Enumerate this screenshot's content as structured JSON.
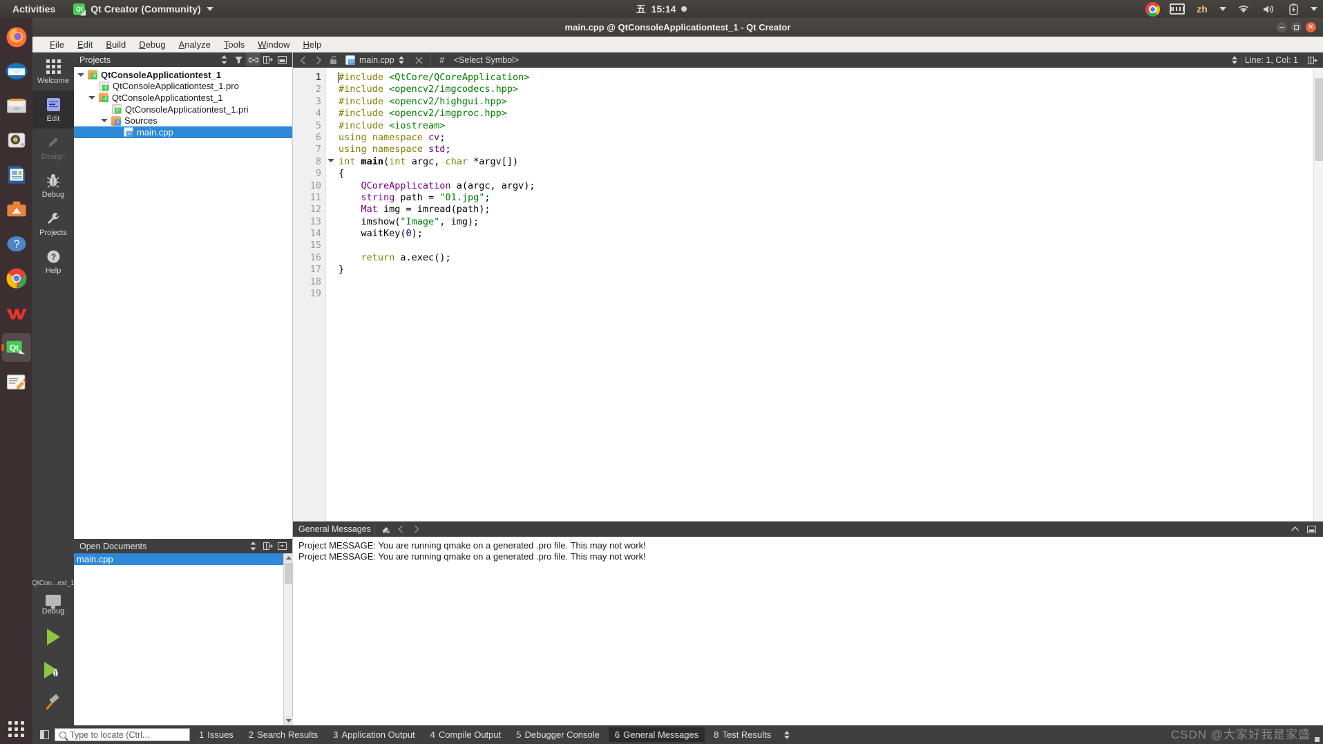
{
  "gnome": {
    "activities": "Activities",
    "app_name": "Qt Creator (Community)",
    "app_icon": "qt-icon",
    "clock_day": "五",
    "clock_time": "15:14",
    "keyboard_layout": "zh",
    "tray_icons": [
      "chrome-icon",
      "keyboard-icon",
      "language-indicator",
      "wifi-icon",
      "volume-icon",
      "battery-icon",
      "system-menu-chevron"
    ]
  },
  "dock": {
    "items": [
      {
        "name": "firefox",
        "label": "Firefox"
      },
      {
        "name": "thunderbird",
        "label": "Thunderbird"
      },
      {
        "name": "files",
        "label": "Files"
      },
      {
        "name": "rhythmbox",
        "label": "Rhythmbox"
      },
      {
        "name": "libreoffice",
        "label": "LibreOffice Writer"
      },
      {
        "name": "ubuntu-software",
        "label": "Ubuntu Software"
      },
      {
        "name": "help",
        "label": "Help"
      },
      {
        "name": "chrome",
        "label": "Google Chrome"
      },
      {
        "name": "wps",
        "label": "WPS Office"
      },
      {
        "name": "qtcreator",
        "label": "Qt Creator",
        "active": true
      },
      {
        "name": "text-editor",
        "label": "Text Editor"
      }
    ],
    "show_apps": "Show Applications"
  },
  "window": {
    "title": "main.cpp @ QtConsoleApplicationtest_1 - Qt Creator",
    "controls": {
      "minimize": "Minimize",
      "maximize": "Maximize",
      "close": "Close"
    }
  },
  "menubar": {
    "items": [
      {
        "label": "File",
        "mnemonic": "F"
      },
      {
        "label": "Edit",
        "mnemonic": "E"
      },
      {
        "label": "Build",
        "mnemonic": "B"
      },
      {
        "label": "Debug",
        "mnemonic": "D"
      },
      {
        "label": "Analyze",
        "mnemonic": "A"
      },
      {
        "label": "Tools",
        "mnemonic": "T"
      },
      {
        "label": "Window",
        "mnemonic": "W"
      },
      {
        "label": "Help",
        "mnemonic": "H"
      }
    ]
  },
  "modes": [
    {
      "label": "Welcome",
      "icon": "grid-icon",
      "state": "normal"
    },
    {
      "label": "Edit",
      "icon": "document-lines-icon",
      "state": "selected"
    },
    {
      "label": "Design",
      "icon": "pencil-icon",
      "state": "disabled"
    },
    {
      "label": "Debug",
      "icon": "bug-icon",
      "state": "normal"
    },
    {
      "label": "Projects",
      "icon": "wrench-icon",
      "state": "normal"
    },
    {
      "label": "Help",
      "icon": "question-circle-icon",
      "state": "normal"
    }
  ],
  "kit_selector": {
    "project": "QtCon...est_1",
    "build_config": "Debug",
    "target_icon": "desktop-icon",
    "run_button": "run-icon",
    "debug_button": "run-debug-icon",
    "build_button": "hammer-icon"
  },
  "projects_panel": {
    "title": "Projects",
    "toolbar": [
      "sync-chevrons-icon",
      "filter-icon",
      "link-icon",
      "split-icon",
      "close-panel-icon"
    ],
    "tree": [
      {
        "label": "QtConsoleApplicationtest_1",
        "depth": 0,
        "icon": "qt-project-folder-icon",
        "expander": "expanded",
        "bold": true,
        "selected": false
      },
      {
        "label": "QtConsoleApplicationtest_1.pro",
        "depth": 1,
        "icon": "qt-file-icon",
        "expander": "none",
        "bold": false,
        "selected": false
      },
      {
        "label": "QtConsoleApplicationtest_1",
        "depth": 1,
        "icon": "qt-project-folder-icon",
        "expander": "expanded",
        "bold": false,
        "selected": false
      },
      {
        "label": "QtConsoleApplicationtest_1.pri",
        "depth": 2,
        "icon": "qt-file-icon",
        "expander": "none",
        "bold": false,
        "selected": false
      },
      {
        "label": "Sources",
        "depth": 2,
        "icon": "cpp-folder-icon",
        "expander": "expanded",
        "bold": false,
        "selected": false
      },
      {
        "label": "main.cpp",
        "depth": 3,
        "icon": "cpp-file-icon",
        "expander": "none",
        "bold": false,
        "selected": true
      }
    ]
  },
  "open_documents": {
    "title": "Open Documents",
    "toolbar": [
      "sync-chevrons-icon",
      "split-icon",
      "close-panel-icon"
    ],
    "items": [
      {
        "label": "main.cpp",
        "selected": true
      }
    ]
  },
  "editor_toolbar": {
    "back": "back-arrow-icon",
    "forward": "forward-arrow-icon",
    "lock": "unlocked-icon",
    "file_icon": "cpp-file-icon",
    "file_name": "main.cpp",
    "close_file": "close-icon",
    "symbol_hash": "#",
    "symbol_selector": "<Select Symbol>",
    "cursor_position": "Line: 1, Col: 1",
    "split_editor": "split-icon"
  },
  "code": {
    "lines": [
      {
        "n": 1,
        "fold": false,
        "tokens": [
          {
            "t": "#include ",
            "c": "pre"
          },
          {
            "t": "<QtCore/QCoreApplication>",
            "c": "str"
          }
        ]
      },
      {
        "n": 2,
        "fold": false,
        "tokens": [
          {
            "t": "#include ",
            "c": "pre"
          },
          {
            "t": "<opencv2/imgcodecs.hpp>",
            "c": "str"
          }
        ]
      },
      {
        "n": 3,
        "fold": false,
        "tokens": [
          {
            "t": "#include ",
            "c": "pre"
          },
          {
            "t": "<opencv2/highgui.hpp>",
            "c": "str"
          }
        ]
      },
      {
        "n": 4,
        "fold": false,
        "tokens": [
          {
            "t": "#include ",
            "c": "pre"
          },
          {
            "t": "<opencv2/imgproc.hpp>",
            "c": "str"
          }
        ]
      },
      {
        "n": 5,
        "fold": false,
        "tokens": [
          {
            "t": "#include ",
            "c": "pre"
          },
          {
            "t": "<iostream>",
            "c": "str"
          }
        ]
      },
      {
        "n": 6,
        "fold": false,
        "tokens": [
          {
            "t": "using namespace ",
            "c": "kw"
          },
          {
            "t": "cv",
            "c": "type"
          },
          {
            "t": ";",
            "c": "plain"
          }
        ]
      },
      {
        "n": 7,
        "fold": false,
        "tokens": [
          {
            "t": "using namespace ",
            "c": "kw"
          },
          {
            "t": "std",
            "c": "type"
          },
          {
            "t": ";",
            "c": "plain"
          }
        ]
      },
      {
        "n": 8,
        "fold": true,
        "tokens": [
          {
            "t": "int ",
            "c": "kw"
          },
          {
            "t": "main",
            "c": "bold"
          },
          {
            "t": "(",
            "c": "plain"
          },
          {
            "t": "int ",
            "c": "kw"
          },
          {
            "t": "argc, ",
            "c": "plain"
          },
          {
            "t": "char ",
            "c": "kw"
          },
          {
            "t": "*argv[])",
            "c": "plain"
          }
        ]
      },
      {
        "n": 9,
        "fold": false,
        "tokens": [
          {
            "t": "{",
            "c": "plain"
          }
        ]
      },
      {
        "n": 10,
        "fold": false,
        "tokens": [
          {
            "t": "    ",
            "c": "plain"
          },
          {
            "t": "QCoreApplication",
            "c": "type"
          },
          {
            "t": " a(argc, argv);",
            "c": "plain"
          }
        ]
      },
      {
        "n": 11,
        "fold": false,
        "tokens": [
          {
            "t": "    ",
            "c": "plain"
          },
          {
            "t": "string",
            "c": "type"
          },
          {
            "t": " path = ",
            "c": "plain"
          },
          {
            "t": "\"01.jpg\"",
            "c": "str"
          },
          {
            "t": ";",
            "c": "plain"
          }
        ]
      },
      {
        "n": 12,
        "fold": false,
        "tokens": [
          {
            "t": "    ",
            "c": "plain"
          },
          {
            "t": "Mat",
            "c": "type"
          },
          {
            "t": " img = imread(path);",
            "c": "plain"
          }
        ]
      },
      {
        "n": 13,
        "fold": false,
        "tokens": [
          {
            "t": "    imshow(",
            "c": "plain"
          },
          {
            "t": "\"Image\"",
            "c": "str"
          },
          {
            "t": ", img);",
            "c": "plain"
          }
        ]
      },
      {
        "n": 14,
        "fold": false,
        "tokens": [
          {
            "t": "    waitKey(",
            "c": "plain"
          },
          {
            "t": "0",
            "c": "num"
          },
          {
            "t": ");",
            "c": "plain"
          }
        ]
      },
      {
        "n": 15,
        "fold": false,
        "tokens": []
      },
      {
        "n": 16,
        "fold": false,
        "tokens": [
          {
            "t": "    ",
            "c": "plain"
          },
          {
            "t": "return ",
            "c": "kw"
          },
          {
            "t": "a.exec();",
            "c": "plain"
          }
        ]
      },
      {
        "n": 17,
        "fold": false,
        "tokens": [
          {
            "t": "}",
            "c": "plain"
          }
        ]
      },
      {
        "n": 18,
        "fold": false,
        "tokens": []
      },
      {
        "n": 19,
        "fold": false,
        "tokens": []
      }
    ]
  },
  "output_pane": {
    "title": "General Messages",
    "toolbar": [
      "clear-icon",
      "prev-item-icon",
      "next-item-icon"
    ],
    "right_controls": [
      "maximize-pane-icon",
      "close-pane-icon"
    ],
    "lines": [
      "Project MESSAGE: You are running qmake on a generated .pro file. This may not work!",
      "Project MESSAGE: You are running qmake on a generated .pro file. This may not work!"
    ]
  },
  "statusbar": {
    "sidebar_toggle": "toggle-sidebar-icon",
    "locator_placeholder": "Type to locate (Ctrl...",
    "locator_value": "",
    "tabs": [
      {
        "n": "1",
        "label": "Issues",
        "active": false
      },
      {
        "n": "2",
        "label": "Search Results",
        "active": false
      },
      {
        "n": "3",
        "label": "Application Output",
        "active": false
      },
      {
        "n": "4",
        "label": "Compile Output",
        "active": false
      },
      {
        "n": "5",
        "label": "Debugger Console",
        "active": false
      },
      {
        "n": "6",
        "label": "General Messages",
        "active": true
      },
      {
        "n": "8",
        "label": "Test Results",
        "active": false
      }
    ]
  },
  "watermark": "CSDN @大家好我是家盛",
  "colors": {
    "accent_selection": "#2e8ad8",
    "qt_green": "#41cd52",
    "ubuntu_orange": "#e95420",
    "dark_chrome": "#3f3f3f",
    "editor_bg": "#ffffff",
    "string_green": "#008000",
    "keyword_olive": "#808000",
    "type_purple": "#800080"
  }
}
